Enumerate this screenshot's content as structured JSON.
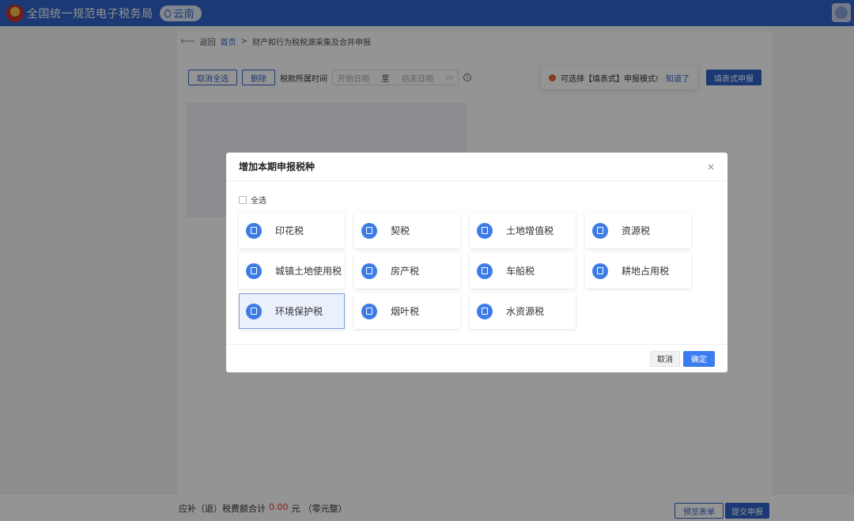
{
  "header": {
    "title": "全国统一规范电子税务局",
    "region": "云南"
  },
  "breadcrumb": {
    "back": "返回",
    "home": "首页",
    "sep": ">",
    "current": "财产和行为税税源采集及合并申报"
  },
  "toolbar": {
    "deselect_all": "取消全选",
    "delete": "删除",
    "period_label": "税款所属时间",
    "start_placeholder": "开始日期",
    "to": "至",
    "end_placeholder": "结束日期"
  },
  "tip": {
    "text": "可选择【填表式】申报模式!",
    "know": "知道了"
  },
  "fill_form_button": "填表式申报",
  "footer": {
    "sum_label": "应补（退）税费额合计",
    "amount": "0.00",
    "unit": "元",
    "amount_words": "（零元整）",
    "preview": "预览表单",
    "submit": "提交申报"
  },
  "modal": {
    "title": "增加本期申报税种",
    "close": "×",
    "select_all": "全选",
    "taxes": [
      {
        "label": "印花税",
        "selected": false
      },
      {
        "label": "契税",
        "selected": false
      },
      {
        "label": "土地增值税",
        "selected": false
      },
      {
        "label": "资源税",
        "selected": false
      },
      {
        "label": "城镇土地使用税",
        "selected": false
      },
      {
        "label": "房产税",
        "selected": false
      },
      {
        "label": "车船税",
        "selected": false
      },
      {
        "label": "耕地占用税",
        "selected": false
      },
      {
        "label": "环境保护税",
        "selected": true
      },
      {
        "label": "烟叶税",
        "selected": false
      },
      {
        "label": "水资源税",
        "selected": false
      }
    ],
    "cancel": "取消",
    "ok": "确定"
  },
  "colors": {
    "brand": "#2f63c9",
    "primary_button": "#3b7df0",
    "icon_bg": "#3d7ce6",
    "amount": "#dd3333"
  }
}
